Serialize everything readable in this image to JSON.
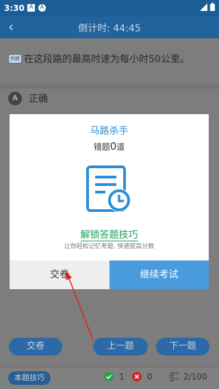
{
  "status_bar": {
    "time": "3:30",
    "icon1": "A",
    "icon2": "A"
  },
  "header": {
    "title": "倒计时: 44:45"
  },
  "question": {
    "tag": "判断",
    "text": "在这段路的最高时速为每小时50公里。"
  },
  "option": {
    "letter": "A",
    "text": "正确"
  },
  "dialog": {
    "title": "马路杀手",
    "wrong_prefix": "错题",
    "wrong_count": "0",
    "wrong_suffix": "道",
    "unlock_link": "解锁答题技巧",
    "desc": "让你轻松记忆考题, 快速提高分数",
    "submit_label": "交卷",
    "continue_label": "继续考试"
  },
  "nav": {
    "submit": "交卷",
    "prev": "上一题",
    "next": "下一题"
  },
  "bottom": {
    "tips": "本题技巧",
    "correct_count": "1",
    "wrong_count": "0",
    "progress": "2/100"
  },
  "colors": {
    "primary": "#22639c",
    "dialog_accent": "#4a9bde",
    "link_green": "#1a9e58",
    "arrow_red": "#e02020"
  }
}
